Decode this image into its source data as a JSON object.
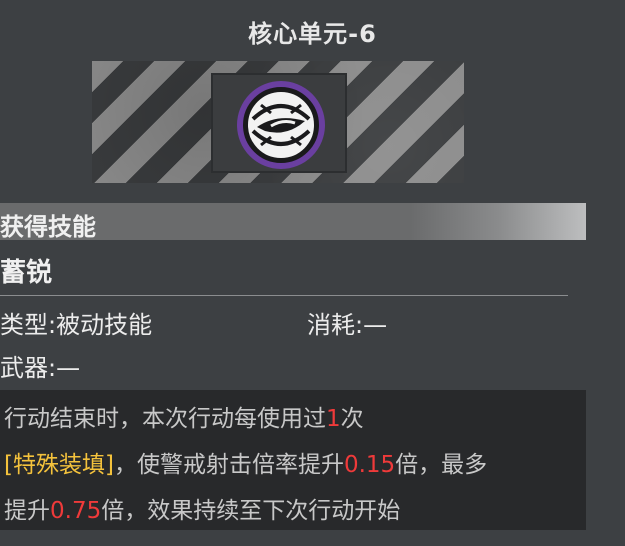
{
  "title": "核心单元-6",
  "header": {
    "label": "获得技能"
  },
  "skill": {
    "name": "蓄锐",
    "type_label": "类型:",
    "type_value": "被动技能",
    "cost_label": "消耗:",
    "cost_value": "—",
    "weapon_label": "武器:",
    "weapon_value": "—"
  },
  "description": {
    "line1_a": "行动结束时，本次行动每使用过",
    "line1_num": "1",
    "line1_b": "次",
    "line2_tag": "[特殊装填]",
    "line2_a": "，使警戒射击倍率提升",
    "line2_num": "0.15",
    "line2_b": "倍，最多",
    "line3_a": "提升",
    "line3_num": "0.75",
    "line3_b": "倍，效果持续至下次行动开始"
  },
  "icon": {
    "name": "sharpened-eye-icon",
    "ring_color": "#6a3fa0"
  },
  "colors": {
    "highlight_red": "#ef3a3a",
    "highlight_gold": "#f4c23c",
    "background": "#3d4043"
  }
}
